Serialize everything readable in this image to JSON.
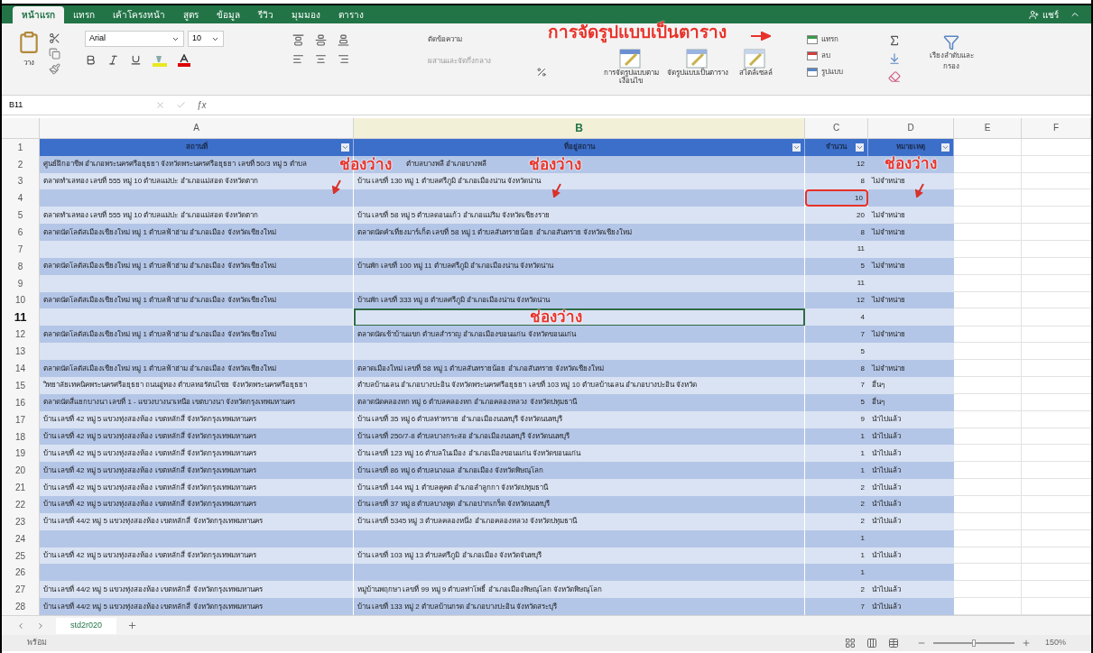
{
  "ribbon_tabs": [
    {
      "label": "หน้าแรก",
      "selected": true
    },
    {
      "label": "แทรก",
      "selected": false
    },
    {
      "label": "เค้าโครงหน้า",
      "selected": false
    },
    {
      "label": "สูตร",
      "selected": false
    },
    {
      "label": "ข้อมูล",
      "selected": false
    },
    {
      "label": "รีวิว",
      "selected": false
    },
    {
      "label": "มุมมอง",
      "selected": false
    },
    {
      "label": "ตาราง",
      "selected": false
    }
  ],
  "share_button": "แชร์",
  "ribbon": {
    "paste": "วาง",
    "font_name": "Arial",
    "font_size": "10",
    "wrap_text": "ตัดข้อความ",
    "merge": "ผสานและจัดกึ่งกลาง",
    "formula_button": "ƒx",
    "conditional_format": "การจัดรูปแบบตามเงื่อนไข",
    "format_as_table": "จัดรูปแบบเป็นตาราง",
    "cell_styles": "สไตล์เซลล์",
    "insert": "แทรก",
    "delete": "ลบ",
    "format": "รูปแบบ",
    "sort_filter": "เรียงลำดับและกรอง"
  },
  "ribbon_annotation": "การจัดรูปแบบเป็นตาราง",
  "name_box": "B11",
  "columns": [
    {
      "label": "A",
      "selected": false
    },
    {
      "label": "B",
      "selected": true
    },
    {
      "label": "C",
      "selected": false
    },
    {
      "label": "D",
      "selected": false
    },
    {
      "label": "E",
      "selected": false
    },
    {
      "label": "F",
      "selected": false
    }
  ],
  "header_row_number": "1",
  "table_headers": [
    "สถานที่",
    "ที่อยู่สถาน",
    "จำนวน",
    "หมายเหตุ"
  ],
  "rows": [
    {
      "number": "2",
      "a": "ศูนย์ฝึกอาชีพ อำเภอพระนครศรีอยุธยา จังหวัดพระนครศรีอยุธยา เลขที่ 50/3 หมู่ 5 ตำบล",
      "b": "ตำบลบางพลี อำเภอบางพลี",
      "c": "12",
      "d": "",
      "selected": false,
      "boxed": false
    },
    {
      "number": "3",
      "a": "ตลาดทำเลทอง เลขที่ 555 หมู่ 10 ตำบลแม่ปะ อำเภอแม่สอด จังหวัดตาก",
      "b": "บ้าน เลขที่ 130 หมู่ 1 ตำบลศรีภูมิ อำเภอเมืองน่าน จังหวัดน่าน",
      "c": "8",
      "d": "ไม่จำหน่าย",
      "selected": false,
      "boxed": false
    },
    {
      "number": "4",
      "a": "",
      "b": "",
      "c": "10",
      "d": "",
      "selected": false,
      "boxed": true
    },
    {
      "number": "5",
      "a": "ตลาดทำเลทอง เลขที่ 555 หมู่ 10 ตำบลแม่ปะ อำเภอแม่สอด จังหวัดตาก",
      "b": "บ้าน เลขที่ 58 หมู่ 5 ตำบลดอนแก้ว อำเภอแม่ริม จังหวัดเชียงราย",
      "c": "20",
      "d": "ไม่จำหน่าย",
      "selected": false,
      "boxed": false
    },
    {
      "number": "6",
      "a": "ตลาดนัดโลตัสเมืองเชียงใหม่ หมู่ 1 ตำบลฟ้าฮ่าม อำเภอเมือง จังหวัดเชียงใหม่",
      "b": "ตลาดนัดคำเที่ยงมาร์เก็ต เลขที่ 58 หมู่ 1 ตำบลสันทรายน้อย อำเภอสันทราย จังหวัดเชียงใหม่",
      "c": "8",
      "d": "ไม่จำหน่าย",
      "selected": false,
      "boxed": false
    },
    {
      "number": "7",
      "a": "",
      "b": "",
      "c": "11",
      "d": "",
      "selected": false,
      "boxed": false
    },
    {
      "number": "8",
      "a": "ตลาดนัดโลตัสเมืองเชียงใหม่ หมู่ 1 ตำบลฟ้าฮ่าม อำเภอเมือง จังหวัดเชียงใหม่",
      "b": "บ้านพัก เลขที่ 100 หมู่ 11 ตำบลศรีภูมิ อำเภอเมืองน่าน จังหวัดน่าน",
      "c": "5",
      "d": "ไม่จำหน่าย",
      "selected": false,
      "boxed": false
    },
    {
      "number": "9",
      "a": "",
      "b": "",
      "c": "11",
      "d": "",
      "selected": false,
      "boxed": false
    },
    {
      "number": "10",
      "a": "ตลาดนัดโลตัสเมืองเชียงใหม่ หมู่ 1 ตำบลฟ้าฮ่าม อำเภอเมือง จังหวัดเชียงใหม่",
      "b": "บ้านพัก เลขที่ 333 หมู่ 8 ตำบลศรีภูมิ อำเภอเมืองน่าน จังหวัดน่าน",
      "c": "12",
      "d": "ไม่จำหน่าย",
      "selected": false,
      "boxed": false
    },
    {
      "number": "11",
      "a": "",
      "b": "",
      "c": "4",
      "d": "",
      "selected": true,
      "boxed": false
    },
    {
      "number": "12",
      "a": "ตลาดนัดโลตัสเมืองเชียงใหม่ หมู่ 1 ตำบลฟ้าฮ่าม อำเภอเมือง จังหวัดเชียงใหม่",
      "b": "ตลาดนัดเช้าบ้านแขก ตำบลสำราญ อำเภอเมืองขอนแก่น จังหวัดขอนแก่น",
      "c": "7",
      "d": "ไม่จำหน่าย",
      "selected": false,
      "boxed": false
    },
    {
      "number": "13",
      "a": "",
      "b": "",
      "c": "5",
      "d": "",
      "selected": false,
      "boxed": false
    },
    {
      "number": "14",
      "a": "ตลาดนัดโลตัสเมืองเชียงใหม่ หมู่ 1 ตำบลฟ้าฮ่าม อำเภอเมือง จังหวัดเชียงใหม่",
      "b": "ตลาดเมืองใหม่ เลขที่ 58 หมู่ 1 ตำบลสันทรายน้อย อำเภอสันทราย จังหวัดเชียงใหม่",
      "c": "8",
      "d": "ไม่จำหน่าย",
      "selected": false,
      "boxed": false
    },
    {
      "number": "15",
      "a": "วิทยาลัยเทคนิคพระนครศรีอยุธยา ถนนอู่ทอง ตำบลหอรัตนไชย จังหวัดพระนครศรีอยุธยา",
      "b": "ตำบลบ้านเลน อำเภอบางปะอิน จังหวัดพระนครศรีอยุธยา เลขที่ 103 หมู่ 10 ตำบลบ้านเลน อำเภอบางปะอิน จังหวัด",
      "c": "7",
      "d": "อื่นๆ",
      "selected": false,
      "boxed": false
    },
    {
      "number": "16",
      "a": "ตลาดนัดสี่แยกบางนา เลขที่ 1 - แขวงบางนาเหนือ เขตบางนา จังหวัดกรุงเทพมหานคร",
      "b": "ตลาดนัดคลองหก หมู่ 6 ตำบลคลองหก อำเภอคลองหลวง จังหวัดปทุมธานี",
      "c": "5",
      "d": "อื่นๆ",
      "selected": false,
      "boxed": false
    },
    {
      "number": "17",
      "a": "บ้าน เลขที่ 42 หมู่ 5 แขวงทุ่งสองห้อง เขตหลักสี่ จังหวัดกรุงเทพมหานคร",
      "b": "บ้าน เลขที่ 35 หมู่ 6 ตำบลท่าทราย อำเภอเมืองนนทบุรี จังหวัดนนทบุรี",
      "c": "9",
      "d": "นำไปแล้ว",
      "selected": false,
      "boxed": false
    },
    {
      "number": "18",
      "a": "บ้าน เลขที่ 42 หมู่ 5 แขวงทุ่งสองห้อง เขตหลักสี่ จังหวัดกรุงเทพมหานคร",
      "b": "บ้าน เลขที่ 250/7-8 ตำบลบางกระสอ อำเภอเมืองนนทบุรี จังหวัดนนทบุรี",
      "c": "1",
      "d": "นำไปแล้ว",
      "selected": false,
      "boxed": false
    },
    {
      "number": "19",
      "a": "บ้าน เลขที่ 42 หมู่ 5 แขวงทุ่งสองห้อง เขตหลักสี่ จังหวัดกรุงเทพมหานคร",
      "b": "บ้าน เลขที่ 123 หมู่ 16 ตำบลในเมือง อำเภอเมืองขอนแก่น จังหวัดขอนแก่น",
      "c": "1",
      "d": "นำไปแล้ว",
      "selected": false,
      "boxed": false
    },
    {
      "number": "20",
      "a": "บ้าน เลขที่ 42 หมู่ 5 แขวงทุ่งสองห้อง เขตหลักสี่ จังหวัดกรุงเทพมหานคร",
      "b": "บ้าน เลขที่ 86 หมู่ 6 ตำบลนางแล อำเภอเมือง จังหวัดพิษณุโลก",
      "c": "1",
      "d": "นำไปแล้ว",
      "selected": false,
      "boxed": false
    },
    {
      "number": "21",
      "a": "บ้าน เลขที่ 42 หมู่ 5 แขวงทุ่งสองห้อง เขตหลักสี่ จังหวัดกรุงเทพมหานคร",
      "b": "บ้าน เลขที่ 144 หมู่ 1 ตำบลคูคต อำเภอลำลูกกา จังหวัดปทุมธานี",
      "c": "2",
      "d": "นำไปแล้ว",
      "selected": false,
      "boxed": false
    },
    {
      "number": "22",
      "a": "บ้าน เลขที่ 42 หมู่ 5 แขวงทุ่งสองห้อง เขตหลักสี่ จังหวัดกรุงเทพมหานคร",
      "b": "บ้าน เลขที่ 37 หมู่ 8 ตำบลบางพูด อำเภอปากเกร็ด จังหวัดนนทบุรี",
      "c": "2",
      "d": "นำไปแล้ว",
      "selected": false,
      "boxed": false
    },
    {
      "number": "23",
      "a": "บ้าน เลขที่ 44/2 หมู่ 5 แขวงทุ่งสองห้อง เขตหลักสี่ จังหวัดกรุงเทพมหานคร",
      "b": "บ้าน เลขที่ 5345 หมู่ 3 ตำบลคลองหนึ่ง อำเภอคลองหลวง จังหวัดปทุมธานี",
      "c": "2",
      "d": "นำไปแล้ว",
      "selected": false,
      "boxed": false
    },
    {
      "number": "24",
      "a": "",
      "b": "",
      "c": "1",
      "d": "",
      "selected": false,
      "boxed": false
    },
    {
      "number": "25",
      "a": "บ้าน เลขที่ 42 หมู่ 5 แขวงทุ่งสองห้อง เขตหลักสี่ จังหวัดกรุงเทพมหานคร",
      "b": "บ้าน เลขที่ 103 หมู่ 13 ตำบลศรีภูมิ อำเภอเมือง จังหวัดจันทบุรี",
      "c": "1",
      "d": "นำไปแล้ว",
      "selected": false,
      "boxed": false
    },
    {
      "number": "26",
      "a": "",
      "b": "",
      "c": "1",
      "d": "",
      "selected": false,
      "boxed": false
    },
    {
      "number": "27",
      "a": "บ้าน เลขที่ 44/2 หมู่ 5 แขวงทุ่งสองห้อง เขตหลักสี่ จังหวัดกรุงเทพมหานคร",
      "b": "หมู่บ้านพฤกษา เลขที่ 99 หมู่ 9 ตำบลท่าโพธิ์ อำเภอเมืองพิษณุโลก จังหวัดพิษณุโลก",
      "c": "2",
      "d": "นำไปแล้ว",
      "selected": false,
      "boxed": false
    },
    {
      "number": "28",
      "a": "บ้าน เลขที่ 44/2 หมู่ 5 แขวงทุ่งสองห้อง เขตหลักสี่ จังหวัดกรุงเทพมหานคร",
      "b": "บ้าน เลขที่ 133 หมู่ 2 ตำบลบ้านกรด อำเภอบางปะอิน จังหวัดสระบุรี",
      "c": "7",
      "d": "นำไปแล้ว",
      "selected": false,
      "boxed": false
    }
  ],
  "annotations": [
    "ช่องว่าง",
    "ช่องว่าง",
    "ช่องว่าง",
    "ช่องว่าง"
  ],
  "sheet_tabs": [
    {
      "label": "std2r020",
      "selected": true
    }
  ],
  "status": "พร้อม",
  "zoom": {
    "level": 0.5,
    "reading": "150%"
  }
}
